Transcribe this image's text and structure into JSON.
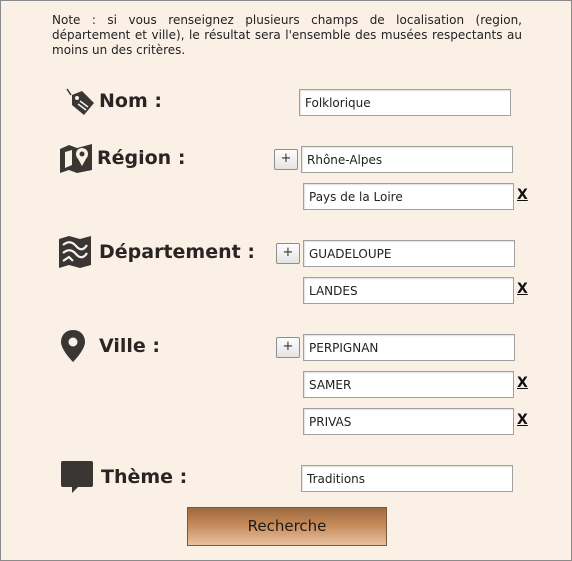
{
  "note": "Note : si vous renseignez plusieurs champs de localisation (region, département et ville), le résultat sera l'ensemble des musées respectants au moins un des critères.",
  "nom": {
    "label": "Nom :",
    "value": "Folklorique"
  },
  "region": {
    "label": "Région :",
    "add_label": "+",
    "values": [
      "Rhône-Alpes",
      "Pays de la Loire"
    ],
    "remove_label": "X"
  },
  "departement": {
    "label": "Département :",
    "add_label": "+",
    "values": [
      "GUADELOUPE",
      "LANDES"
    ],
    "remove_label": "X"
  },
  "ville": {
    "label": "Ville :",
    "add_label": "+",
    "values": [
      "PERPIGNAN",
      "SAMER",
      "PRIVAS"
    ],
    "remove_label": "X"
  },
  "theme": {
    "label": "Thème :",
    "value": "Traditions"
  },
  "search_label": "Recherche",
  "icons": {
    "nom": "price-tag-icon",
    "region": "map-marker-icon",
    "departement": "folded-map-icon",
    "ville": "location-pin-icon",
    "theme": "speech-bubble-icon"
  },
  "colors": {
    "background": "#fbf0e6",
    "button": "#c48a5a",
    "text": "#2a2522"
  }
}
